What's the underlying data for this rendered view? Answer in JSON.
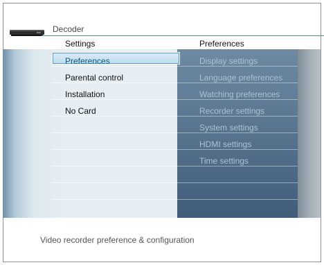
{
  "header": {
    "title": "Decoder"
  },
  "columns": {
    "left_title": "Settings",
    "right_title": "Preferences"
  },
  "left_menu": [
    {
      "label": "Preferences",
      "selected": true
    },
    {
      "label": "Parental control",
      "selected": false
    },
    {
      "label": "Installation",
      "selected": false
    },
    {
      "label": "No Card",
      "selected": false
    }
  ],
  "right_menu": [
    {
      "label": "Display settings"
    },
    {
      "label": "Language preferences"
    },
    {
      "label": "Watching preferences"
    },
    {
      "label": "Recorder settings"
    },
    {
      "label": "System settings"
    },
    {
      "label": "HDMI settings"
    },
    {
      "label": "Time settings"
    }
  ],
  "footer": {
    "description": "Video recorder preference & configuration"
  },
  "icons": {
    "device": "set-top-box-icon"
  },
  "colors": {
    "accent": "#4b8fb2",
    "selected_text": "#0b5a82",
    "panel_dark": "#405c79",
    "submenu_text": "#aec1d2"
  }
}
